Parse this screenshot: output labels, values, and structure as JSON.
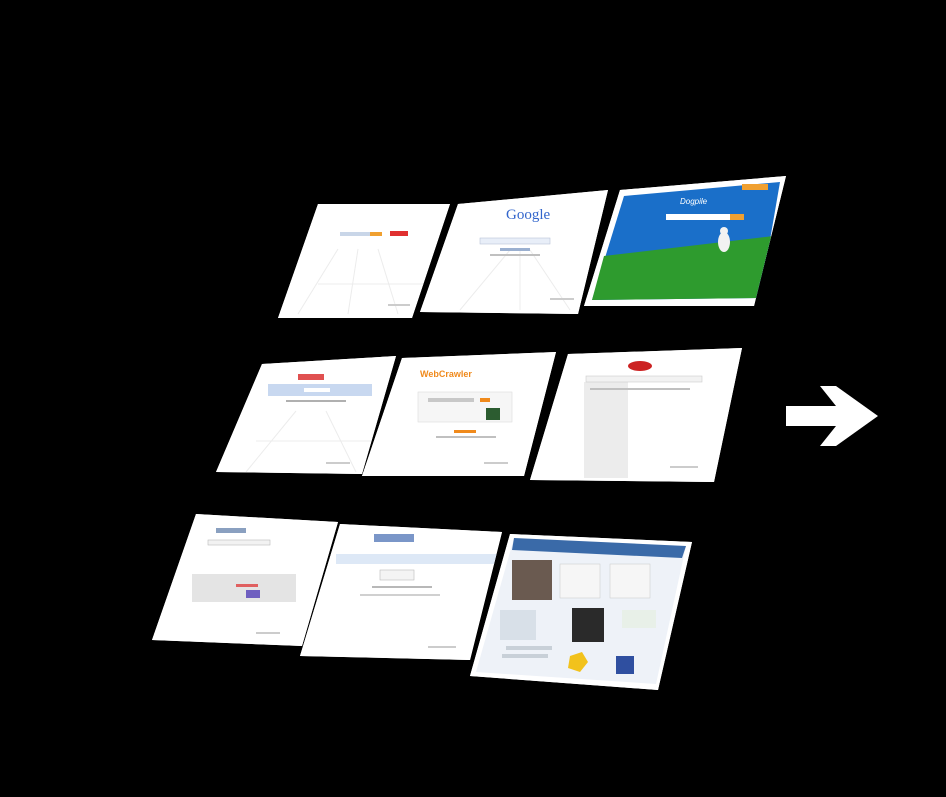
{
  "background_color": "#000000",
  "thumbnails": [
    {
      "id": "thumb-1",
      "site_name": "",
      "style": "blank-search",
      "bg": "#ffffff"
    },
    {
      "id": "thumb-2",
      "site_name": "Google",
      "style": "google",
      "bg": "#ffffff"
    },
    {
      "id": "thumb-3",
      "site_name": "Dogpile",
      "style": "dogpile",
      "bg": "#1a6fc9",
      "ground": "#2e9b2e"
    },
    {
      "id": "thumb-4",
      "site_name": "",
      "style": "blue-header",
      "bg": "#ffffff"
    },
    {
      "id": "thumb-5",
      "site_name": "WebCrawler",
      "style": "webcrawler",
      "bg": "#ffffff"
    },
    {
      "id": "thumb-6",
      "site_name": "",
      "style": "red-logo",
      "bg": "#ffffff"
    },
    {
      "id": "thumb-7",
      "site_name": "",
      "style": "gray-box",
      "bg": "#ffffff"
    },
    {
      "id": "thumb-8",
      "site_name": "",
      "style": "blue-band",
      "bg": "#ffffff"
    },
    {
      "id": "thumb-9",
      "site_name": "",
      "style": "news-portal",
      "bg": "#ffffff"
    }
  ],
  "next_button": {
    "icon": "arrow-right-icon",
    "color": "#ffffff"
  }
}
